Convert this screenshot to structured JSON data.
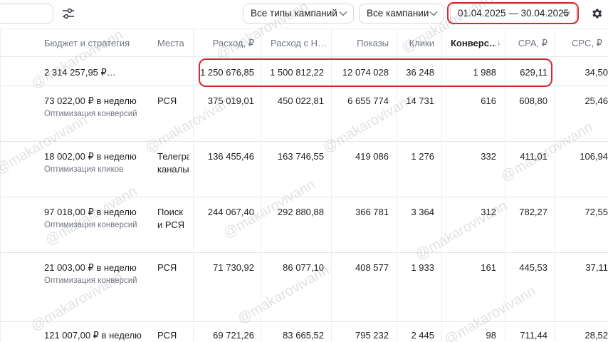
{
  "toolbar": {
    "campaign_types": "Все типы кампаний",
    "campaigns": "Все кампании",
    "date_range": "01.04.2025 — 30.04.2025"
  },
  "table": {
    "columns": {
      "budget": "Бюджет и стратегия",
      "places": "Места",
      "spend": "Расход, ₽",
      "spend_vat": "Расход с Н…",
      "impressions": "Показы",
      "clicks": "Клики",
      "conversions": "Конверс…",
      "sort_arrow": "↓",
      "cpa": "CPA, ₽",
      "cpc": "CPC, ₽"
    },
    "total": {
      "budget": "2 314 257,95 ₽…",
      "spend": "1 250 676,85",
      "spend_vat": "1 500 812,22",
      "impressions": "12 074 028",
      "clicks": "36 248",
      "conversions": "1 988",
      "cpa": "629,11",
      "cpc": "34,50"
    },
    "rows": [
      {
        "budget": "73 022,00 ₽ в неделю",
        "strategy": "Оптимизация конверсий",
        "place1": "РСЯ",
        "place2": "",
        "spend": "375 019,01",
        "spend_vat": "450 022,81",
        "impressions": "6 655 774",
        "clicks": "14 731",
        "conversions": "616",
        "cpa": "608,80",
        "cpc": "25,46"
      },
      {
        "budget": "18 002,00 ₽ в неделю",
        "strategy": "Оптимизация кликов",
        "place1": "Телегра",
        "place2": "каналы",
        "spend": "136 455,46",
        "spend_vat": "163 746,55",
        "impressions": "419 086",
        "clicks": "1 276",
        "conversions": "332",
        "cpa": "411,01",
        "cpc": "106,94"
      },
      {
        "budget": "97 018,00 ₽ в неделю",
        "strategy": "Оптимизация конверсий",
        "place1": "Поиск",
        "place2": "и РСЯ",
        "spend": "244 067,40",
        "spend_vat": "292 880,88",
        "impressions": "366 781",
        "clicks": "3 364",
        "conversions": "312",
        "cpa": "782,27",
        "cpc": "72,55"
      },
      {
        "budget": "21 003,00 ₽ в неделю",
        "strategy": "Оптимизация конверсий",
        "place1": "РСЯ",
        "place2": "",
        "spend": "71 730,92",
        "spend_vat": "86 077,10",
        "impressions": "408 577",
        "clicks": "1 933",
        "conversions": "161",
        "cpa": "445,53",
        "cpc": "37,11"
      },
      {
        "budget": "121 007,00 ₽ в неделю",
        "strategy": "",
        "place1": "РСЯ",
        "place2": "",
        "spend": "69 721,26",
        "spend_vat": "83 665,52",
        "impressions": "795 232",
        "clicks": "2 445",
        "conversions": "98",
        "cpa": "711,44",
        "cpc": "28,52"
      }
    ]
  },
  "watermark": "@makarovivann",
  "colors": {
    "highlight": "#d9262c",
    "muted": "#707680",
    "border": "#e4e6ea"
  },
  "icons": {
    "filter": "sliders-icon",
    "settings": "gear-icon",
    "dropdown": "chevron-down-icon"
  }
}
